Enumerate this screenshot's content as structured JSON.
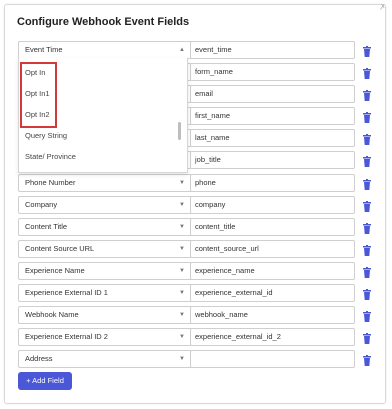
{
  "title": "Configure Webhook Event Fields",
  "add_button": "+ Add Field",
  "colors": {
    "accent": "#4a58d8",
    "highlight": "#d23a3a",
    "trash": "#4a58d8"
  },
  "dropdown_options": [
    "Opt In",
    "Opt In1",
    "Opt In2",
    "Query String",
    "State/ Province"
  ],
  "rows": [
    {
      "select": "Event Time",
      "value": "event_time"
    },
    {
      "select": "",
      "value": "form_name"
    },
    {
      "select": "",
      "value": "email"
    },
    {
      "select": "",
      "value": "first_name"
    },
    {
      "select": "",
      "value": "last_name"
    },
    {
      "select": "",
      "value": "job_title"
    },
    {
      "select": "Phone Number",
      "value": "phone"
    },
    {
      "select": "Company",
      "value": "company"
    },
    {
      "select": "Content Title",
      "value": "content_title"
    },
    {
      "select": "Content Source URL",
      "value": "content_source_url"
    },
    {
      "select": "Experience Name",
      "value": "experience_name"
    },
    {
      "select": "Experience External ID 1",
      "value": "experience_external_id"
    },
    {
      "select": "Webhook Name",
      "value": "webhook_name"
    },
    {
      "select": "Experience External ID 2",
      "value": "experience_external_id_2"
    },
    {
      "select": "Address",
      "value": ""
    }
  ]
}
